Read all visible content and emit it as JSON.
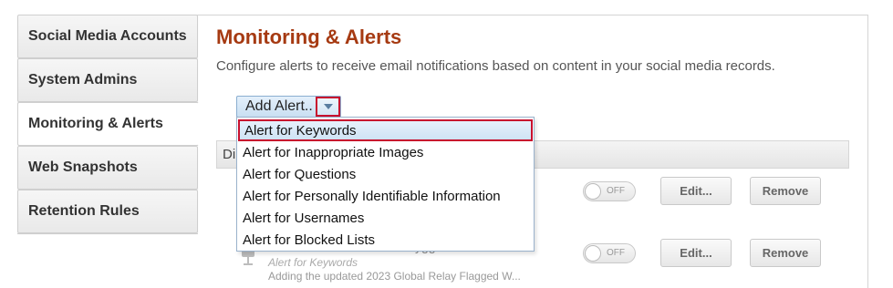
{
  "sidebar": {
    "items": [
      {
        "label": "Social Media Accounts"
      },
      {
        "label": "System Admins"
      },
      {
        "label": "Monitoring & Alerts"
      },
      {
        "label": "Web Snapshots"
      },
      {
        "label": "Retention Rules"
      }
    ],
    "active_index": 2
  },
  "main": {
    "title": "Monitoring & Alerts",
    "description": "Configure alerts to receive email notifications based on content in your social media records."
  },
  "add_alert": {
    "label": "Add Alert..",
    "menu": [
      "Alert for Keywords",
      "Alert for Inappropriate Images",
      "Alert for Questions",
      "Alert for Personally Identifiable Information",
      "Alert for Usernames",
      "Alert for Blocked Lists"
    ],
    "highlighted_index": 0
  },
  "table": {
    "header_partial": "Di",
    "rows": [
      {
        "subtitle": "",
        "detail_fragment": "...",
        "toggle": "OFF",
        "edit": "Edit...",
        "remove": "Remove"
      },
      {
        "title_fragment": "ygg",
        "subtitle": "Alert for Keywords",
        "detail": "Adding the updated 2023 Global Relay Flagged W...",
        "toggle": "OFF",
        "edit": "Edit...",
        "remove": "Remove"
      }
    ]
  },
  "colors": {
    "accent_title": "#a63a12",
    "highlight_border": "#c8102e",
    "menu_border": "#9ab2cc"
  }
}
